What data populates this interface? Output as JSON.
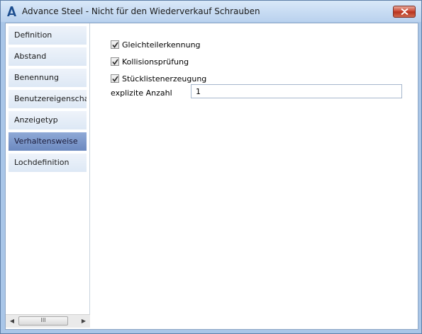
{
  "window": {
    "title": "Advance Steel - Nicht für den Wiederverkauf  Schrauben",
    "close_icon": "close-icon",
    "app_icon": "advance-steel-logo"
  },
  "sidebar": {
    "items": [
      {
        "label": "Definition",
        "selected": false
      },
      {
        "label": "Abstand",
        "selected": false
      },
      {
        "label": "Benennung",
        "selected": false
      },
      {
        "label": "Benutzereigenscha...",
        "selected": false
      },
      {
        "label": "Anzeigetyp",
        "selected": false
      },
      {
        "label": "Verhaltensweise",
        "selected": true
      },
      {
        "label": "Lochdefinition",
        "selected": false
      }
    ],
    "scrollbar": {
      "thumb_glyph": "III",
      "left_arrow": "◀",
      "right_arrow": "▶"
    }
  },
  "main": {
    "checkboxes": [
      {
        "label": "Gleichteilerkennung",
        "checked": true
      },
      {
        "label": "Kollisionsprüfung",
        "checked": true
      },
      {
        "label": "Stücklistenerzeugung",
        "checked": true
      }
    ],
    "count_field": {
      "label": "explizite Anzahl",
      "value": "1"
    }
  },
  "colors": {
    "selected_nav": "#7a95c9",
    "frame": "#a9c6e8",
    "close_button": "#c7412c"
  }
}
